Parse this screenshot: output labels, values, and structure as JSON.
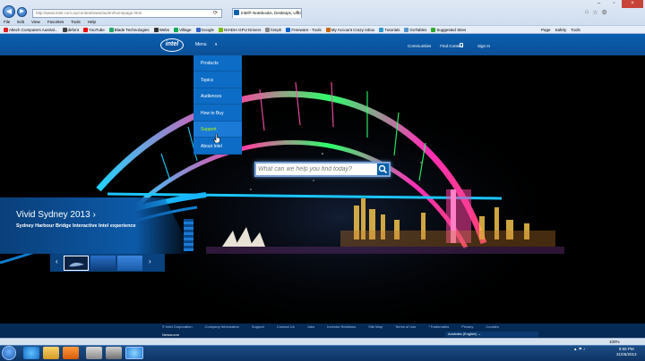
{
  "browser": {
    "address": "http://www.intel.com.au/content/www/au/en/homepage.html",
    "tab_label": "Intel® Notebooks, Desktops, Ultra...",
    "tab_close": "×",
    "window_controls": [
      "–",
      "▫",
      "×"
    ],
    "menu": [
      "File",
      "Edit",
      "View",
      "Favorites",
      "Tools",
      "Help"
    ],
    "favorites": [
      {
        "label": "Altech Computers Austral...",
        "color": "#d22"
      },
      {
        "label": "defont",
        "color": "#444"
      },
      {
        "label": "YouTube",
        "color": "#e00"
      },
      {
        "label": "Blade Technologies",
        "color": "#2a6"
      },
      {
        "label": "Webs",
        "color": "#333"
      },
      {
        "label": "Village",
        "color": "#0a5"
      },
      {
        "label": "Google",
        "color": "#36c"
      },
      {
        "label": "NVIDIA GPU Drivers",
        "color": "#7b0"
      },
      {
        "label": "kimph",
        "color": "#888"
      },
      {
        "label": "Freeware - Tools",
        "color": "#06c"
      },
      {
        "label": "My Account Crazy Inbox",
        "color": "#c60"
      },
      {
        "label": "Tutorials",
        "color": "#39c"
      },
      {
        "label": "GoTables",
        "color": "#59c"
      },
      {
        "label": "Suggested Sites",
        "color": "#3a3"
      }
    ],
    "commands": [
      "Page",
      "Safety",
      "Tools"
    ],
    "zoom": "100%"
  },
  "site": {
    "logo": "intel",
    "menu_label": "Menu",
    "nav_right": [
      "Communities",
      "Find Content",
      "Sign In"
    ],
    "dropdown": [
      {
        "label": "Products",
        "active": false
      },
      {
        "label": "Topics",
        "active": false
      },
      {
        "label": "Audiences",
        "active": false
      },
      {
        "label": "How to Buy",
        "active": false
      },
      {
        "label": "Support",
        "active": true
      },
      {
        "label": "About Intel",
        "active": false
      }
    ],
    "search_placeholder": "What can we help you find today?",
    "hero_title": "Vivid Sydney 2013",
    "hero_sub": "Sydney Harbour Bridge Interactive Intel experience",
    "footer_links": [
      "© Intel Corporation",
      "Company Information",
      "Support",
      "Contact Us",
      "Jobs",
      "Investor Relations",
      "Site Map",
      "Terms of Use",
      "*Trademarks",
      "Privacy",
      "Cookies"
    ],
    "footer_row2": "Newsroom",
    "region": "Australia (English) ⌄"
  },
  "taskbar": {
    "tray": "▲ ⚑ ♪",
    "time": "8:55 PM",
    "date": "31/05/2013"
  },
  "colors": {
    "intel_blue": "#0860a8",
    "active_green": "#b7ff00"
  }
}
